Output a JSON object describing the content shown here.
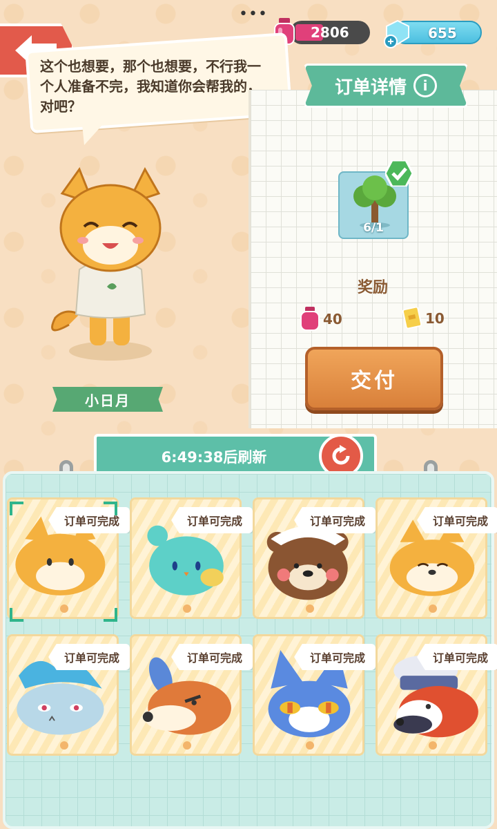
{
  "resources": {
    "ink": "2806",
    "gems": "655"
  },
  "dialogue": {
    "text": "这个也想要，那个也想要，不行我一个人准备不完，我知道你会帮我的，对吧？"
  },
  "character": {
    "name": "小日月"
  },
  "order_panel": {
    "title": "订单详情",
    "item_count": "6/1",
    "reward_title": "奖励",
    "rewards": [
      {
        "icon": "ink-bottle-icon",
        "amount": "40"
      },
      {
        "icon": "coin-ticket-icon",
        "amount": "10"
      }
    ],
    "deliver_label": "交付"
  },
  "refresh": {
    "text": "6:49:38后刷新"
  },
  "orders": [
    {
      "character": "orange-cat",
      "tag": "订单可完成",
      "selected": true
    },
    {
      "character": "blue-bear",
      "tag": "订单可完成"
    },
    {
      "character": "brown-bear",
      "tag": "订单可完成"
    },
    {
      "character": "shiba-dog",
      "tag": "订单可完成"
    },
    {
      "character": "grey-wolf",
      "tag": "订单可完成"
    },
    {
      "character": "orange-dog",
      "tag": "订单可完成"
    },
    {
      "character": "blue-cat",
      "tag": "订单可完成"
    },
    {
      "character": "chef-dog",
      "tag": "订单可完成"
    }
  ],
  "colors": {
    "accent_green": "#5db99a",
    "refresh_red": "#e35a47",
    "deliver_orange": "#e08c45"
  }
}
